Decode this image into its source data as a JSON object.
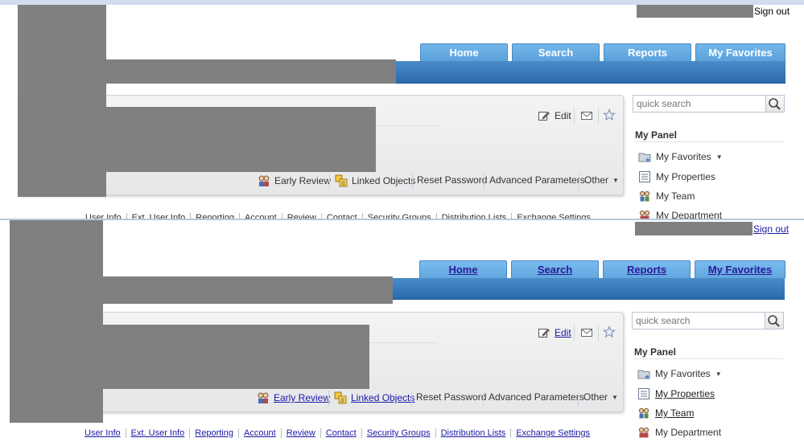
{
  "header": {
    "sign_out": "Sign out"
  },
  "tabs": [
    "Home",
    "Search",
    "Reports",
    "My Favorites"
  ],
  "actions": {
    "edit": "Edit",
    "early_review": "Early Review",
    "linked_objects": "Linked Objects",
    "reset_password": "Reset Password",
    "advanced_parameters": "Advanced Parameters",
    "other": "Other"
  },
  "search": {
    "placeholder": "quick search"
  },
  "panel": {
    "title": "My Panel",
    "items": [
      "My Favorites",
      "My Properties",
      "My Team",
      "My Department"
    ]
  },
  "subnav": [
    "User Info",
    "Ext. User Info",
    "Reporting",
    "Account",
    "Review",
    "Contact",
    "Security Groups",
    "Distribution Lists",
    "Exchange Settings"
  ],
  "colors": {
    "tab": "#5aa2dc",
    "bar": "#2a69ac",
    "link": "#1a1aa6",
    "redaction": "#808080"
  }
}
